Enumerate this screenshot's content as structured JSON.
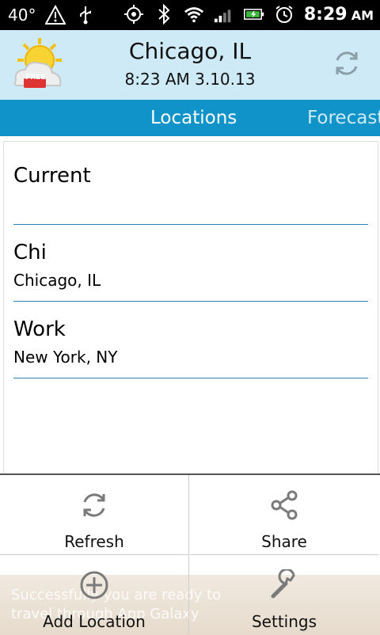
{
  "status_bar": {
    "temperature": "40°",
    "time": "8:29",
    "ampm": "AM",
    "icons": [
      "warning-icon",
      "usb-icon",
      "gps-icon",
      "bluetooth-icon",
      "wifi-icon",
      "signal-icon",
      "battery-icon",
      "alarm-icon"
    ]
  },
  "header": {
    "app_badge": "FREE",
    "city": "Chicago, IL",
    "updated": "8:23 AM 3.10.13",
    "refresh_icon": "refresh-icon"
  },
  "tabs": {
    "active": "Locations",
    "next": "Forecast"
  },
  "locations": [
    {
      "name": "Current",
      "location": ""
    },
    {
      "name": "Chi",
      "location": "Chicago, IL"
    },
    {
      "name": "Work",
      "location": "New York, NY"
    }
  ],
  "menu": {
    "items": [
      {
        "label": "Refresh",
        "icon": "refresh-icon"
      },
      {
        "label": "Share",
        "icon": "share-icon"
      },
      {
        "label": "Add Location",
        "icon": "add-icon"
      },
      {
        "label": "Settings",
        "icon": "wrench-icon"
      }
    ]
  },
  "ad": {
    "text_line1": "Successfully you are ready to",
    "text_line2": "travel through App Galaxy"
  }
}
